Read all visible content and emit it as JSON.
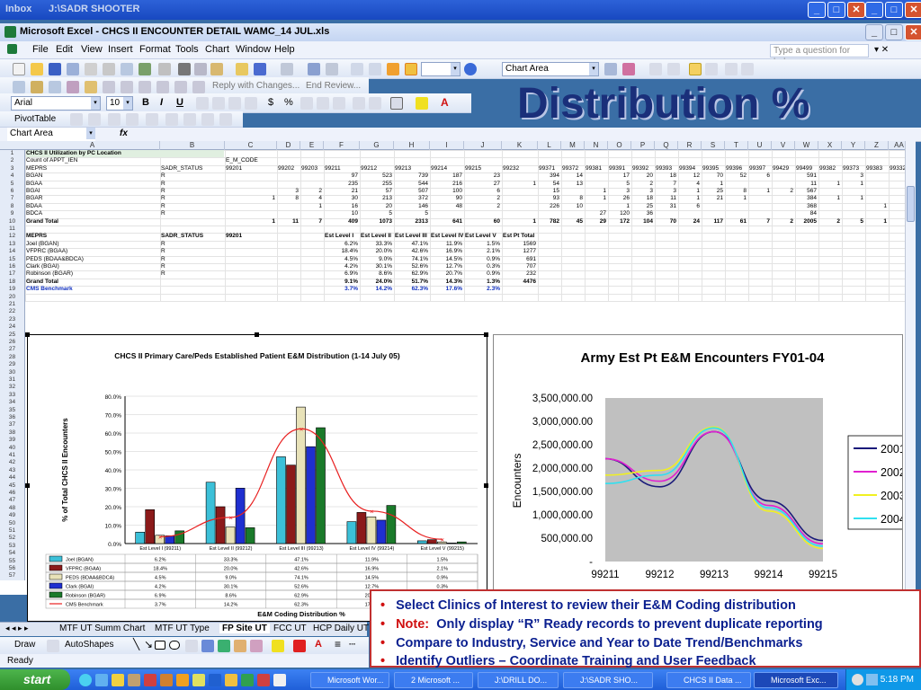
{
  "background_window": {
    "tab1": "Inbox",
    "tab2": "J:\\SADR SHOOTER"
  },
  "excel": {
    "title": "Microsoft Excel - CHCS II ENCOUNTER DETAIL WAMC_14 JUL.xls",
    "menus": [
      "File",
      "Edit",
      "View",
      "Insert",
      "Format",
      "Tools",
      "Chart",
      "Window",
      "Help"
    ],
    "help_placeholder": "Type a question for help",
    "chart_area_select": "Chart Area",
    "reply_with_changes": "Reply with Changes...",
    "end_review": "End Review...",
    "font_name": "Arial",
    "font_size": "10",
    "pivot_table": "PivotTable",
    "name_box": "Chart Area",
    "fx": "fx"
  },
  "slide_title": "Distribution %",
  "columns": [
    "A",
    "B",
    "C",
    "D",
    "E",
    "F",
    "G",
    "H",
    "I",
    "J",
    "K",
    "L",
    "M",
    "N",
    "O",
    "P",
    "Q",
    "R",
    "S",
    "T",
    "U",
    "V",
    "W",
    "X",
    "Y",
    "Z",
    "AA"
  ],
  "rows": [
    "1",
    "2",
    "3",
    "4",
    "5",
    "6",
    "7",
    "8",
    "9",
    "10",
    "11",
    "12",
    "13",
    "14",
    "15",
    "16",
    "17",
    "18",
    "19",
    "20",
    "21",
    "22",
    "23",
    "24",
    "25",
    "26",
    "27",
    "28",
    "29",
    "30",
    "31",
    "32",
    "33",
    "34",
    "35",
    "36",
    "37",
    "38",
    "39",
    "40",
    "41",
    "42",
    "43",
    "44",
    "45",
    "46",
    "47",
    "48",
    "49",
    "50",
    "51",
    "52",
    "53",
    "54",
    "55",
    "56",
    "57"
  ],
  "pivot": {
    "title": "CHCS II Utilization by PC Location",
    "count_label": "Count of APPT_IEN",
    "e_m_code": "E_M_CODE",
    "meprs_hdr": "MEPRS",
    "sadr_hdr": "SADR_STATUS",
    "code_headers": [
      "99201",
      "99202",
      "99203",
      "99211",
      "99212",
      "99213",
      "99214",
      "99215",
      "99232",
      "99371",
      "99372",
      "99381",
      "99391",
      "99392",
      "99393",
      "99394",
      "99395",
      "99396",
      "99397",
      "99429",
      "99499",
      "99382",
      "99373",
      "99383",
      "99332"
    ],
    "rows": [
      {
        "meprs": "BGAN",
        "status": "R",
        "vals": [
          "",
          "",
          "",
          "97",
          "523",
          "739",
          "187",
          "23",
          "",
          "394",
          "14",
          "",
          "17",
          "20",
          "18",
          "12",
          "70",
          "52",
          "6",
          "",
          "591",
          "",
          "3",
          "",
          ""
        ]
      },
      {
        "meprs": "BGAA",
        "status": "R",
        "vals": [
          "",
          "",
          "",
          "235",
          "255",
          "544",
          "216",
          "27",
          "1",
          "54",
          "13",
          "",
          "5",
          "2",
          "7",
          "4",
          "1",
          "",
          "",
          "",
          "11",
          "1",
          "1",
          "",
          ""
        ]
      },
      {
        "meprs": "BGAI",
        "status": "R",
        "vals": [
          "",
          "3",
          "2",
          "21",
          "57",
          "507",
          "100",
          "6",
          "",
          "15",
          "",
          "1",
          "3",
          "3",
          "3",
          "1",
          "25",
          "8",
          "1",
          "2",
          "567",
          "",
          "",
          "",
          ""
        ]
      },
      {
        "meprs": "BGAR",
        "status": "R",
        "vals": [
          "1",
          "8",
          "4",
          "30",
          "213",
          "372",
          "90",
          "2",
          "",
          "93",
          "8",
          "1",
          "26",
          "18",
          "11",
          "1",
          "21",
          "1",
          "",
          "",
          "384",
          "1",
          "1",
          "",
          ""
        ]
      },
      {
        "meprs": "BDAA",
        "status": "R",
        "vals": [
          "",
          "",
          "1",
          "16",
          "20",
          "146",
          "48",
          "2",
          "",
          "226",
          "10",
          "",
          "1",
          "25",
          "31",
          "6",
          "",
          "",
          "",
          "",
          "368",
          "",
          "",
          "1",
          ""
        ]
      },
      {
        "meprs": "BDCA",
        "status": "R",
        "vals": [
          "",
          "",
          "",
          "10",
          "5",
          "5",
          "",
          "",
          "",
          "",
          "",
          "27",
          "120",
          "36",
          "",
          "",
          "",
          "",
          "",
          "",
          "84",
          "",
          "",
          "",
          ""
        ]
      }
    ],
    "grand_total_label": "Grand Total",
    "grand_total": [
      "1",
      "11",
      "7",
      "409",
      "1073",
      "2313",
      "641",
      "60",
      "1",
      "782",
      "45",
      "29",
      "172",
      "104",
      "70",
      "24",
      "117",
      "61",
      "7",
      "2",
      "2005",
      "2",
      "5",
      "1",
      "2"
    ]
  },
  "summary": {
    "meprs_hdr": "MEPRS",
    "sadr_hdr": "SADR_STATUS",
    "code": "99201",
    "col_headers": [
      "Est Level I",
      "Est Level II",
      "Est Level III",
      "Est Level IV",
      "Est Level V",
      "Est Pt Total"
    ],
    "rows": [
      {
        "label": "Joel (BGAN)",
        "status": "R",
        "vals": [
          "6.2%",
          "33.3%",
          "47.1%",
          "11.9%",
          "1.5%",
          "1569"
        ]
      },
      {
        "label": "VFPRC (BGAA)",
        "status": "R",
        "vals": [
          "18.4%",
          "20.0%",
          "42.6%",
          "16.9%",
          "2.1%",
          "1277"
        ]
      },
      {
        "label": "PEDS (BDAA&BDCA)",
        "status": "R",
        "vals": [
          "4.5%",
          "9.0%",
          "74.1%",
          "14.5%",
          "0.9%",
          "691"
        ]
      },
      {
        "label": "Clark (BGAI)",
        "status": "R",
        "vals": [
          "4.2%",
          "30.1%",
          "52.6%",
          "12.7%",
          "0.3%",
          "707"
        ]
      },
      {
        "label": "Robinson (BGAR)",
        "status": "R",
        "vals": [
          "6.9%",
          "8.6%",
          "62.9%",
          "20.7%",
          "0.9%",
          "232"
        ]
      }
    ],
    "grand_total_label": "Grand Total",
    "grand_total": [
      "9.1%",
      "24.0%",
      "51.7%",
      "14.3%",
      "1.3%",
      "4476"
    ],
    "benchmark_label": "CMS Benchmark",
    "benchmark": [
      "3.7%",
      "14.2%",
      "62.3%",
      "17.6%",
      "2.3%"
    ]
  },
  "chart_data": [
    {
      "type": "bar",
      "title": "CHCS II Primary Care/Peds Established Patient E&M Distribution (1-14 July 05)",
      "xlabel": "E&M Coding Distribution %",
      "ylabel": "% of Total CHCS II Encounters",
      "ylim": [
        0,
        80
      ],
      "yticks": [
        "0.0%",
        "10.0%",
        "20.0%",
        "30.0%",
        "40.0%",
        "50.0%",
        "60.0%",
        "70.0%",
        "80.0%"
      ],
      "categories": [
        "Est Level I (99211)",
        "Est Level II (99212)",
        "Est Level III (99213)",
        "Est Level IV (99214)",
        "Est Level V (99215)"
      ],
      "series": [
        {
          "name": "Joel (BGAN)",
          "values": [
            6.2,
            33.3,
            47.1,
            11.9,
            1.5
          ],
          "labels": [
            "6.2%",
            "33.3%",
            "47.1%",
            "11.9%",
            "1.5%"
          ],
          "color": "#3cc0d8"
        },
        {
          "name": "VFPRC (BGAA)",
          "values": [
            18.4,
            20.0,
            42.6,
            16.9,
            2.1
          ],
          "labels": [
            "18.4%",
            "20.0%",
            "42.6%",
            "16.9%",
            "2.1%"
          ],
          "color": "#8b1a1a"
        },
        {
          "name": "PEDS (BDAA&BDCA)",
          "values": [
            4.5,
            9.0,
            74.1,
            14.5,
            0.9
          ],
          "labels": [
            "4.5%",
            "9.0%",
            "74.1%",
            "14.5%",
            "0.9%"
          ],
          "color": "#e8e2b8"
        },
        {
          "name": "Clark (BGAI)",
          "values": [
            4.2,
            30.1,
            52.6,
            12.7,
            0.3
          ],
          "labels": [
            "4.2%",
            "30.1%",
            "52.6%",
            "12.7%",
            "0.3%"
          ],
          "color": "#1f2fd0"
        },
        {
          "name": "Robinson (BGAR)",
          "values": [
            6.9,
            8.6,
            62.9,
            20.7,
            0.9
          ],
          "labels": [
            "6.9%",
            "8.6%",
            "62.9%",
            "20.7%",
            "0.9%"
          ],
          "color": "#1a7a2a"
        },
        {
          "name": "CMS Benchmark",
          "type": "line",
          "values": [
            3.7,
            14.2,
            62.3,
            17.6,
            2.3
          ],
          "labels": [
            "3.7%",
            "14.2%",
            "62.3%",
            "17.6%",
            "2.3%"
          ],
          "color": "#e82020"
        }
      ]
    },
    {
      "type": "line",
      "title": "Army Est Pt  E&M Encounters FY01-04",
      "ylabel": "Encounters",
      "categories": [
        "99211",
        "99212",
        "99213",
        "99214",
        "99215"
      ],
      "yticks": [
        "-",
        "500,000.00",
        "1,000,000.00",
        "1,500,000.00",
        "2,000,000.00",
        "2,500,000.00",
        "3,000,000.00",
        "3,500,000.00"
      ],
      "ylim": [
        0,
        3500000
      ],
      "legend": "right",
      "series": [
        {
          "name": "2001",
          "values": [
            2200000,
            1600000,
            2780000,
            1300000,
            450000
          ],
          "color": "#1a1a7a"
        },
        {
          "name": "2002",
          "values": [
            2200000,
            1720000,
            2780000,
            1200000,
            380000
          ],
          "color": "#e020d0"
        },
        {
          "name": "2003",
          "values": [
            1850000,
            1950000,
            2880000,
            1080000,
            280000
          ],
          "color": "#f0f020"
        },
        {
          "name": "2004",
          "values": [
            1670000,
            1850000,
            2860000,
            1150000,
            330000
          ],
          "color": "#30e0f0"
        }
      ]
    }
  ],
  "sheet_tabs": [
    "MTF UT Summ Chart",
    "MTF UT Type",
    "FP Site UT",
    "FCC UT",
    "HCP Daily UT"
  ],
  "active_tab": "FP Site UT",
  "draw_bar": {
    "draw": "Draw",
    "autoshapes": "AutoShapes"
  },
  "status": "Ready",
  "bullets": [
    {
      "text": "Select Clinics of Interest to review their E&M Coding distribution"
    },
    {
      "note": "Note:",
      "text": "Only display “R” Ready records to prevent duplicate reporting"
    },
    {
      "text": "Compare to Industry, Service and Year to Date Trend/Benchmarks"
    },
    {
      "text": "Identify Outliers – Coordinate Training and User Feedback"
    }
  ],
  "taskbar": {
    "start": "start",
    "tasks": [
      "Microsoft Wor...",
      "2 Microsoft ...",
      "J:\\DRILL DO...",
      "J:\\SADR SHO...",
      "CHCS II Data ...",
      "Microsoft Exc..."
    ],
    "active_task": "Microsoft Exc...",
    "clock": "5:18 PM"
  }
}
